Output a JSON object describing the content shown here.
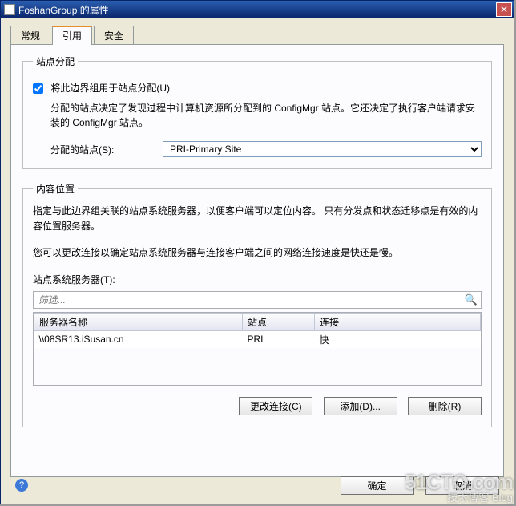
{
  "window": {
    "title": "FoshanGroup 的属性"
  },
  "tabs": {
    "general": "常规",
    "references": "引用",
    "security": "安全"
  },
  "group1": {
    "legend": "站点分配",
    "checkbox_label": "将此边界组用于站点分配(U)",
    "desc": "分配的站点决定了发现过程中计算机资源所分配到的 ConfigMgr 站点。它还决定了执行客户端请求安装的 ConfigMgr 站点。",
    "site_label": "分配的站点(S):",
    "site_value": "PRI-Primary Site"
  },
  "group2": {
    "legend": "内容位置",
    "desc1": "指定与此边界组关联的站点系统服务器，以便客户端可以定位内容。  只有分发点和状态迁移点是有效的内容位置服务器。",
    "desc2": "您可以更改连接以确定站点系统服务器与连接客户端之间的网络连接速度是快还是慢。",
    "servers_label": "站点系统服务器(T):",
    "filter_placeholder": "筛选...",
    "headers": {
      "server": "服务器名称",
      "site": "站点",
      "conn": "连接"
    },
    "rows": [
      {
        "server": "\\\\08SR13.iSusan.cn",
        "site": "PRI",
        "conn": "快"
      }
    ],
    "btn_change": "更改连接(C)",
    "btn_add": "添加(D)...",
    "btn_remove": "删除(R)"
  },
  "dlg": {
    "ok": "确定",
    "cancel": "取消"
  },
  "watermark": {
    "l1": "51CTO.com",
    "l2": "技术博客       Blog"
  }
}
